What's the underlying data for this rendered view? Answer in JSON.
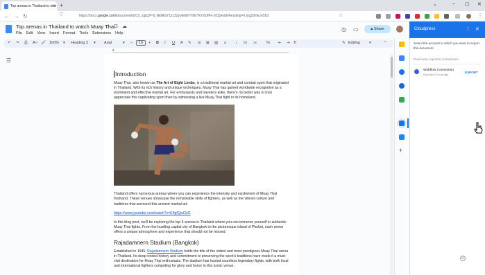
{
  "browser": {
    "tab_title": "Top arenas in Thailand to watch Muay Thai",
    "tab_close": "×",
    "new_tab": "+",
    "url_prefix": "https://docs.",
    "url_host": "google.com",
    "url_rest": "/document/d/12_zgbZP-8_NkMlaY11c3ZyvE6bVY8k7XXXzffFx-0ZQ/edit#heading=h.tyg18mkze563"
  },
  "docs": {
    "title": "Top arenas in Thailand to watch Muay Thai",
    "menu": [
      "File",
      "Edit",
      "View",
      "Insert",
      "Format",
      "Tools",
      "Extensions",
      "Help"
    ],
    "share_label": "Share",
    "toolbar": {
      "zoom": "100%",
      "style": "Heading 2",
      "font": "Arial",
      "font_size": "16",
      "mode": "Editing"
    }
  },
  "document": {
    "h_intro": "Introduction",
    "p1_a": "Muay Thai, also known as ",
    "p1_bold": "The Art of Eight Limbs",
    "p1_b": ", is a traditional martial art and combat sport that originated in Thailand. With its rich history and unique techniques, Muay Thai has gained worldwide recognition as a prominent and effective martial art. For enthusiasts and travelers alike, there's no better way to truly appreciate this captivating sport than by witnessing a live Muay Thai fight in its homeland.",
    "p2": "Thailand offers numerous arenas where you can experience the intensity and excitement of Muay Thai firsthand. These venues showcase the remarkable skills of fighters, as well as the vibrant culture and traditions that surround this ancient martial art.",
    "link": "https://www.youtube.com/watch?v=EIfgfQwCb2I",
    "p3": "In this blog post, we'll be exploring the top 6 arenas in Thailand where you can immerse yourself in authentic Muay Thai fights. From the bustling capital city of Bangkok to the picturesque island of Phuket, each arena offers a unique atmosphere and experience that should not be missed.",
    "h_rajad": "Rajadamnern Stadium (Bangkok)",
    "p4_a": "Established in 1945, ",
    "p4_link": "Rajadamnern Stadium",
    "p4_b": " holds the title of the oldest and most prestigious Muay Thai arena in Thailand. Its deep-rooted history and commitment to preserving the sport's traditions have made it a must-visit destination for Muay Thai enthusiasts. The stadium has hosted countless legendary fights, with both local and international fighters competing for glory and honor in this iconic venue."
  },
  "panel": {
    "title": "Cloudpress",
    "description": "Select the account to which you want to export this document",
    "previous_label": "Previously exported connections",
    "connection_name": "Webflow Connection",
    "connection_time": "Exported 3 hours ago",
    "export_label": "EXPORT"
  },
  "colors": {
    "accent": "#1a73e8",
    "share_bg": "#c2e7ff"
  }
}
